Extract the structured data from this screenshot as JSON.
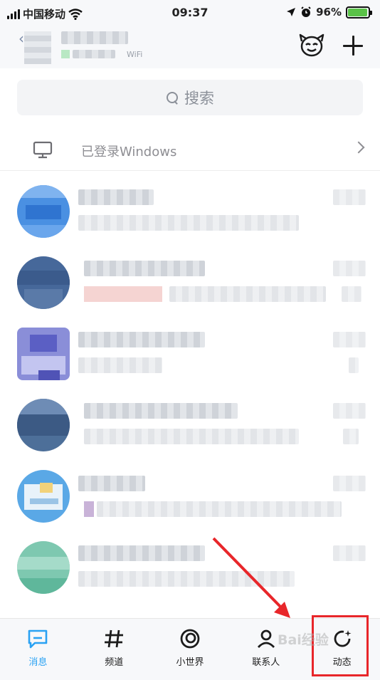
{
  "status_bar": {
    "carrier": "中国移动",
    "time": "09:37",
    "battery": "96%"
  },
  "header": {
    "status_text": "WiFi"
  },
  "search": {
    "placeholder": "搜索"
  },
  "device_row": {
    "label": "已登录Windows"
  },
  "tabs": [
    {
      "label": "消息",
      "icon": "message-icon",
      "active": true
    },
    {
      "label": "频道",
      "icon": "hashtag-icon"
    },
    {
      "label": "小世界",
      "icon": "world-icon"
    },
    {
      "label": "联系人",
      "icon": "contacts-icon"
    },
    {
      "label": "动态",
      "icon": "refresh-star-icon"
    }
  ],
  "watermark": {
    "text": "Bai经验"
  },
  "colors": {
    "accent": "#2aa2f3",
    "annotation": "#e8262a",
    "battery": "#5ac247"
  }
}
